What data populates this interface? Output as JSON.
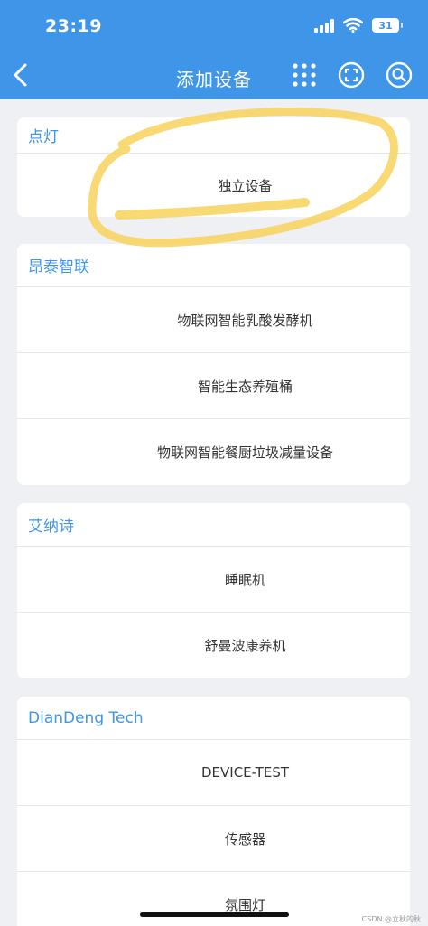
{
  "status_bar": {
    "time": "23:19",
    "battery": "31"
  },
  "header": {
    "title": "添加设备"
  },
  "sections": [
    {
      "title": "点灯",
      "items": [
        "独立设备"
      ]
    },
    {
      "title": "昂泰智联",
      "items": [
        "物联网智能乳酸发酵机",
        "智能生态养殖桶",
        "物联网智能餐厨垃圾减量设备"
      ]
    },
    {
      "title": "艾纳诗",
      "items": [
        "睡眠机",
        "舒曼波康养机"
      ]
    },
    {
      "title": "DianDeng Tech",
      "items": [
        "DEVICE-TEST",
        "传感器",
        "氛围灯"
      ]
    }
  ],
  "watermark": "CSDN @立秋的秋",
  "colors": {
    "accent": "#3f95e8",
    "highlight": "#f7d25a",
    "background": "#eef0f3"
  }
}
